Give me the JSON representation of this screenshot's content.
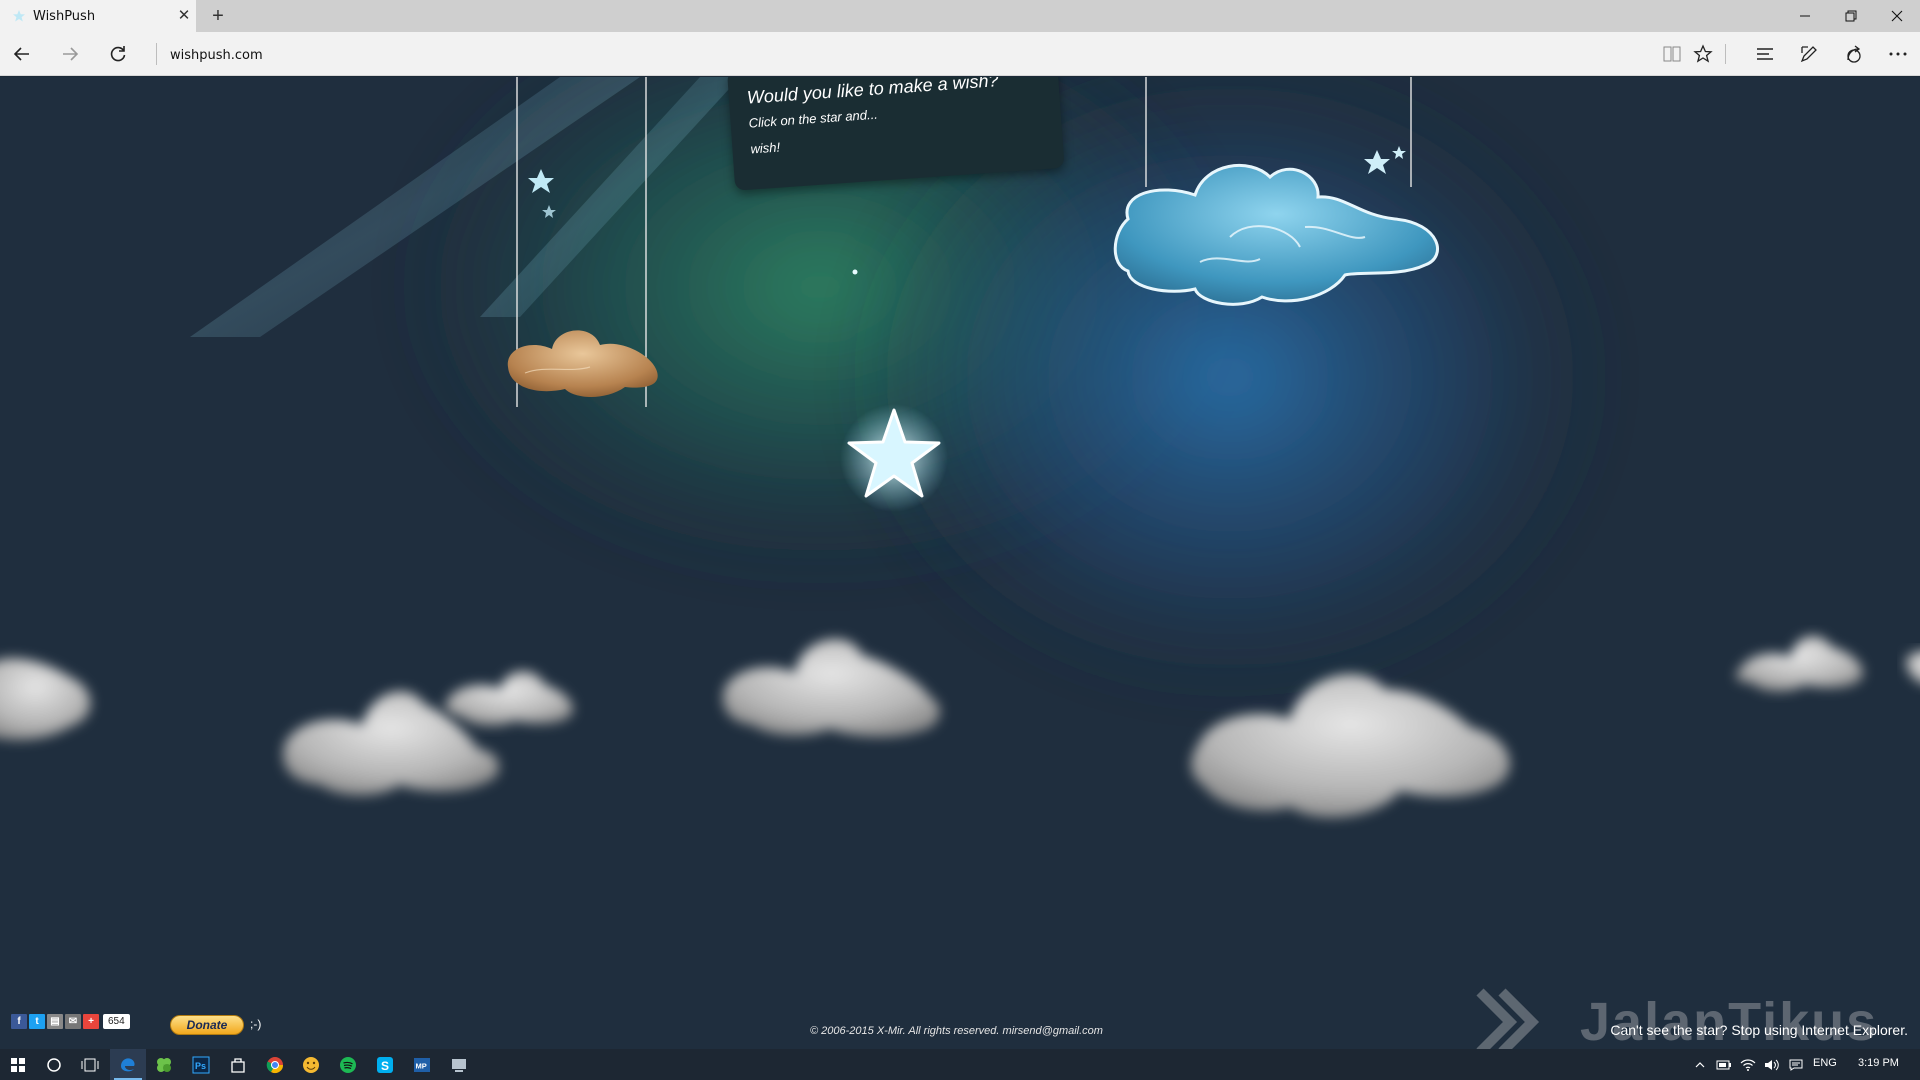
{
  "browser": {
    "tab_title": "WishPush",
    "url": "wishpush.com",
    "colors": {
      "tabbar": "#cfcfcf",
      "toolbar": "#f2f2f2"
    }
  },
  "wish_panel": {
    "title": "Would you like to make a wish?",
    "line1": "Click on the star and...",
    "line2": "wish!"
  },
  "footer": {
    "share_count": "654",
    "donate_label": "Donate",
    "smiley": ";-)",
    "copyright": "© 2006-2015 X-Mir. All rights reserved. mirsend@gmail.com",
    "ie_note": "Can't see the star? Stop using Internet Explorer.",
    "watermark_icon": "jalantikus-logo"
  },
  "taskbar": {
    "language": "ENG",
    "time": "3:19 PM"
  }
}
